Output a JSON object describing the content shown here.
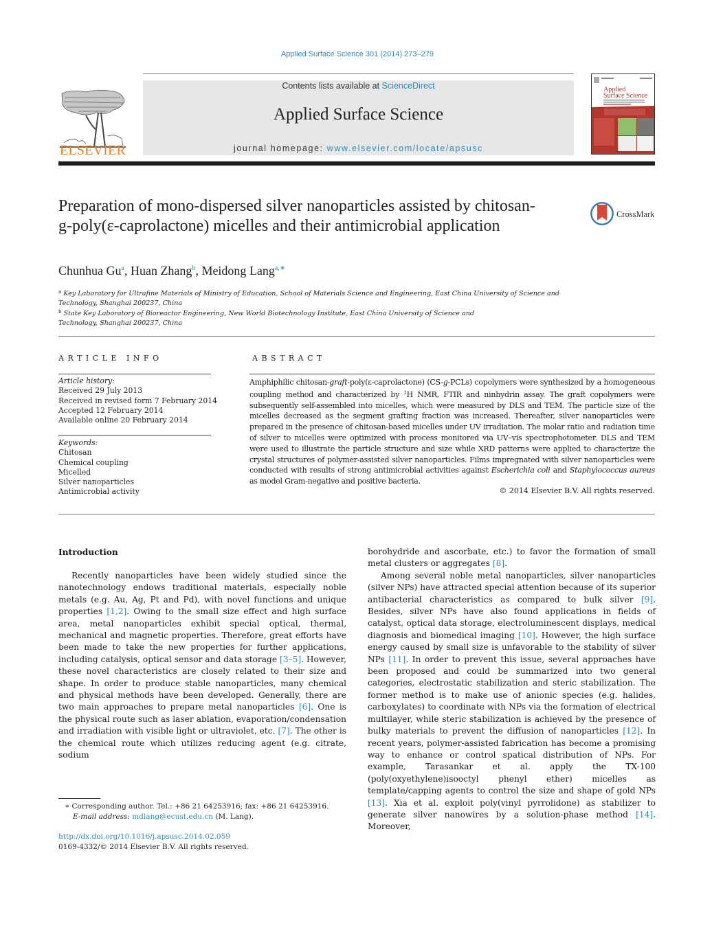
{
  "journal_ref": "Applied Surface Science 301 (2014) 273–279",
  "header": {
    "publisher_logo_text": "ELSEVIER",
    "contents_prefix": "Contents lists available at ",
    "contents_link": "ScienceDirect",
    "journal_name": "Applied Surface Science",
    "homepage_prefix": "journal homepage: ",
    "homepage_link": "www.elsevier.com/locate/apsusc",
    "cover_title_line1": "Applied",
    "cover_title_line2": "Surface Science"
  },
  "crossmark_label": "CrossMark",
  "title": "Preparation of mono-dispersed silver nanoparticles assisted by chitosan-g-poly(ε-caprolactone) micelles and their antimicrobial application",
  "authors": [
    {
      "name": "Chunhua Gu",
      "sup": "a"
    },
    {
      "name": "Huan Zhang",
      "sup": "b"
    },
    {
      "name": "Meidong Lang",
      "sup": "a,∗"
    }
  ],
  "affiliations": [
    {
      "sup": "a",
      "text": "Key Laboratory for Ultrafine Materials of Ministry of Education, School of Materials Science and Engineering, East China University of Science and Technology, Shanghai 200237, China"
    },
    {
      "sup": "b",
      "text": "State Key Laboratory of Bioreactor Engineering, New World Biotechnology Institute, East China University of Science and Technology, Shanghai 200237, China"
    }
  ],
  "article_info": {
    "heading": "ARTICLE INFO",
    "history_label": "Article history:",
    "history": [
      "Received 29 July 2013",
      "Received in revised form 7 February 2014",
      "Accepted 12 February 2014",
      "Available online 20 February 2014"
    ],
    "keywords_label": "Keywords:",
    "keywords": [
      "Chitosan",
      "Chemical coupling",
      "Micelled",
      "Silver nanoparticles",
      "Antimicrobial activity"
    ]
  },
  "abstract": {
    "heading": "ABSTRACT",
    "p1": "Amphiphilic chitosan-",
    "p1_i": "graft",
    "p2": "-poly(ε-caprolactone) (CS-",
    "p2_i": "g",
    "p3": "-PCLs) copolymers were synthesized by a homogeneous coupling method and characterized by ",
    "p3_sup": "1",
    "p4": "H NMR, FTIR and ninhydrin assay. The graft copolymers were subsequently self-assembled into micelles, which were measured by DLS and TEM. The particle size of the micelles decreased as the segment grafting fraction was increased. Thereafter, silver nanoparticles were prepared in the presence of chitosan-based micelles under UV irradiation. The molar ratio and radiation time of silver to micelles were optimized with process monitored via UV–vis spectrophotometer. DLS and TEM were used to illustrate the particle structure and size while XRD patterns were applied to characterize the crystal structures of polymer-assisted silver nanoparticles. Films impregnated with silver nanoparticles were conducted with results of strong antimicrobial activities against ",
    "p4_i": "Escherichia coli",
    "p5": " and ",
    "p5_i": "Staphylococcus aureus",
    "p6": " as model Gram-negative and positive bacteria.",
    "copyright": "© 2014 Elsevier B.V. All rights reserved."
  },
  "body": {
    "intro_heading": "Introduction",
    "left": {
      "t1": "Recently nanoparticles have been widely studied since the nanotechnology endows traditional materials, especially noble metals (e.g. Au, Ag, Pt and Pd), with novel functions and unique properties ",
      "c1": "[1,2]",
      "t2": ". Owing to the small size effect and high surface area, metal nanoparticles exhibit special optical, thermal, mechanical and magnetic properties. Therefore, great efforts have been made to take the new properties for further applications, including catalysis, optical sensor and data storage ",
      "c2": "[3–5]",
      "t3": ". However, these novel characteristics are closely related to their size and shape. In order to produce stable nanoparticles, many chemical and physical methods have been developed. Generally, there are two main approaches to prepare metal nanoparticles ",
      "c3": "[6]",
      "t4": ". One is the physical route such as laser ablation, evaporation/condensation and irradiation with visible light or ultraviolet, etc. ",
      "c4": "[7]",
      "t5": ". The other is the chemical route which utilizes reducing agent (e.g. citrate, sodium"
    },
    "right": {
      "t1": "borohydride and ascorbate, etc.) to favor the formation of small metal clusters or aggregates ",
      "c1": "[8]",
      "t2": ".",
      "p2_t1": "Among several noble metal nanoparticles, silver nanoparticles (silver NPs) have attracted special attention because of its superior antibacterial characteristics as compared to bulk silver ",
      "p2_c1": "[9]",
      "p2_t2": ". Besides, silver NPs have also found applications in fields of catalyst, optical data storage, electroluminescent displays, medical diagnosis and biomedical imaging ",
      "p2_c2": "[10]",
      "p2_t3": ". However, the high surface energy caused by small size is unfavorable to the stability of silver NPs ",
      "p2_c3": "[11]",
      "p2_t4": ". In order to prevent this issue, several approaches have been proposed and could be summarized into two general categories, electrostatic stabilization and steric stabilization. The former method is to make use of anionic species (e.g. halides, carboxylates) to coordinate with NPs via the formation of electrical multilayer, while steric stabilization is achieved by the presence of bulky materials to prevent the diffusion of nanoparticles ",
      "p2_c4": "[12]",
      "p2_t5": ". In recent years, polymer-assisted fabrication has become a promising way to enhance or control spatical distribution of NPs. For example, Tarasankar et al. apply the TX-100 (poly(oxyethylene)isooctyl phenyl ether) micelles as template/capping agents to control the size and shape of gold NPs ",
      "p2_c5": "[13]",
      "p2_t6": ". Xia et al. exploit poly(vinyl pyrrolidone) as stabilizer to generate silver nanowires by a solution-phase method ",
      "p2_c6": "[14]",
      "p2_t7": ". Moreover,"
    }
  },
  "footnote": {
    "star": "∗",
    "corresponding": " Corresponding author. Tel.: +86 21 64253916; fax: +86 21 64253916.",
    "email_label": "E-mail address:",
    "email": "mdlang@ecust.edu.cn",
    "email_suffix": " (M. Lang)."
  },
  "doi": "http://dx.doi.org/10.1016/j.apsusc.2014.02.059",
  "issn_line": "0169-4332/© 2014 Elsevier B.V. All rights reserved."
}
